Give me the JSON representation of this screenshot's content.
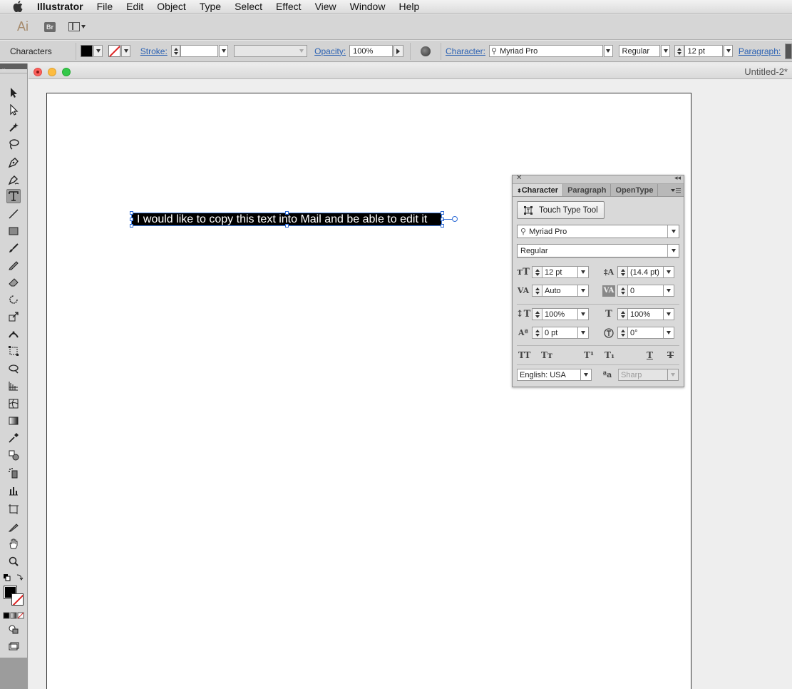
{
  "menubar": {
    "app": "Illustrator",
    "items": [
      "File",
      "Edit",
      "Object",
      "Type",
      "Select",
      "Effect",
      "View",
      "Window",
      "Help"
    ]
  },
  "appbar": {
    "ai_logo": "Ai",
    "br_logo": "Br"
  },
  "control": {
    "selection_label": "Characters",
    "stroke_label": "Stroke:",
    "stroke_value": "",
    "opacity_label": "Opacity:",
    "opacity_value": "100%",
    "character_label": "Character:",
    "font_family": "Myriad Pro",
    "font_style": "Regular",
    "font_size": "12 pt",
    "paragraph_label": "Paragraph:"
  },
  "document": {
    "title": "Untitled-2*",
    "selected_text": "I would like to copy this text into Mail and be able to edit it"
  },
  "character_panel": {
    "tabs": [
      "Character",
      "Paragraph",
      "OpenType"
    ],
    "touch_type_label": "Touch Type Tool",
    "font_family": "Myriad Pro",
    "font_style": "Regular",
    "font_size": "12 pt",
    "leading": "(14.4 pt)",
    "kerning": "Auto",
    "tracking": "0",
    "vertical_scale": "100%",
    "horizontal_scale": "100%",
    "baseline_shift": "0 pt",
    "rotation": "0°",
    "language": "English: USA",
    "antialiasing": "Sharp"
  },
  "colors": {
    "link_blue": "#2c62b3",
    "selection_blue": "#2d6bd6",
    "panel_bg": "#d9d9d9"
  }
}
